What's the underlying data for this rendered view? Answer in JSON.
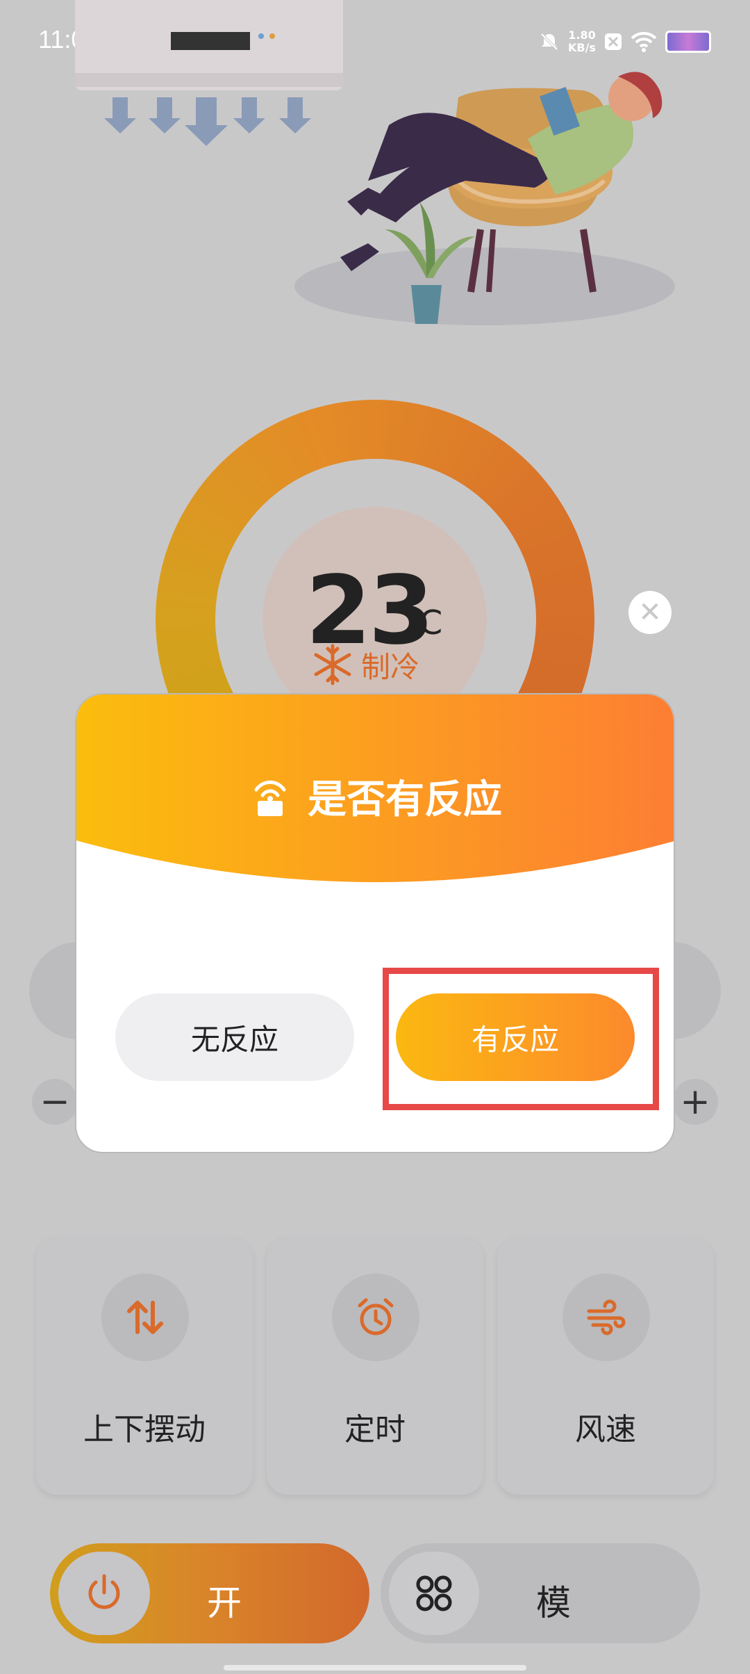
{
  "status_bar": {
    "time": "11:04",
    "net_speed_value": "1.80",
    "net_speed_unit": "KB/s"
  },
  "thermostat": {
    "temperature": "23",
    "unit": "℃",
    "mode": "制冷"
  },
  "dialog": {
    "title": "是否有反应",
    "no_response": "无反应",
    "has_response": "有反应"
  },
  "features": [
    {
      "label": "上下摆动",
      "icon": "swing-arrows-icon"
    },
    {
      "label": "定时",
      "icon": "alarm-clock-icon"
    },
    {
      "label": "风速",
      "icon": "wind-icon"
    }
  ],
  "controls": {
    "power_label": "开",
    "mode_label": "模",
    "minus": "−",
    "plus": "+"
  },
  "colors": {
    "accent_orange": "#d96a2a",
    "gradient_start": "#fbb811",
    "gradient_end": "#fc8a2c",
    "highlight": "#e74848"
  }
}
